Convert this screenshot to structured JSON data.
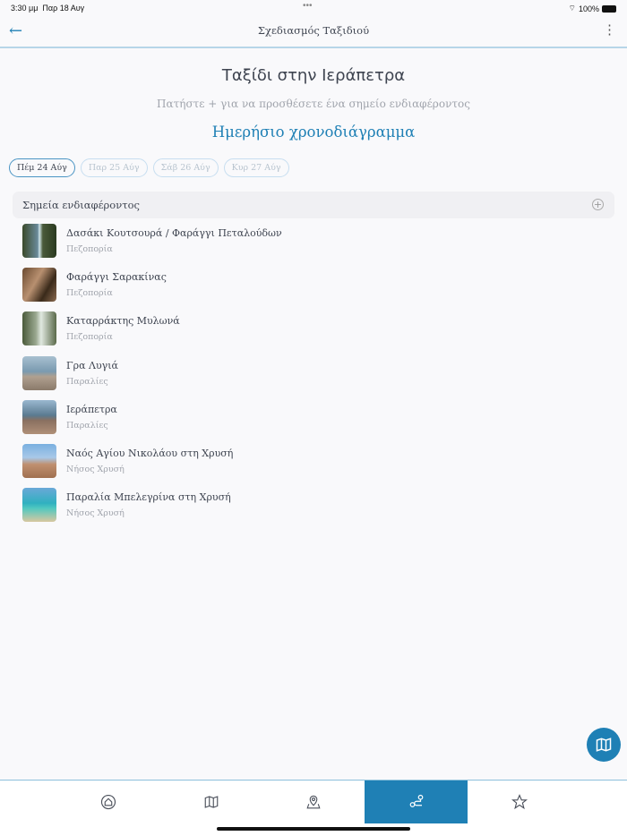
{
  "status": {
    "time": "3:30 μμ",
    "date": "Παρ 18 Αυγ",
    "battery": "100%"
  },
  "nav": {
    "title": "Σχεδιασμός Ταξιδιού"
  },
  "trip": {
    "title": "Ταξίδι στην Ιεράπετρα",
    "hint": "Πατήστε + για να προσθέσετε ένα σημείο ενδιαφέροντος",
    "schedule": "Ημερήσιο χρονοδιάγραμμα"
  },
  "days": [
    {
      "label": "Πέμ 24 Αύγ",
      "active": true
    },
    {
      "label": "Παρ 25 Αύγ"
    },
    {
      "label": "Σάβ 26 Αύγ"
    },
    {
      "label": "Κυρ 27 Αύγ"
    }
  ],
  "poi": {
    "header": "Σημεία ενδιαφέροντος",
    "items": [
      {
        "name": "Δασάκι Κουτσουρά / Φαράγγι Πεταλούδων",
        "category": "Πεζοπορία"
      },
      {
        "name": "Φαράγγι Σαρακίνας",
        "category": "Πεζοπορία"
      },
      {
        "name": "Καταρράκτης Μυλωνά",
        "category": "Πεζοπορία"
      },
      {
        "name": "Γρα Λυγιά",
        "category": "Παραλίες"
      },
      {
        "name": "Ιεράπετρα",
        "category": "Παραλίες"
      },
      {
        "name": "Ναός Αγίου Νικολάου στη Χρυσή",
        "category": "Νήσος Χρυσή"
      },
      {
        "name": "Παραλία Μπελεγρίνα στη Χρυσή",
        "category": "Νήσος Χρυσή"
      }
    ]
  },
  "colors": {
    "accent": "#1f80b5"
  }
}
